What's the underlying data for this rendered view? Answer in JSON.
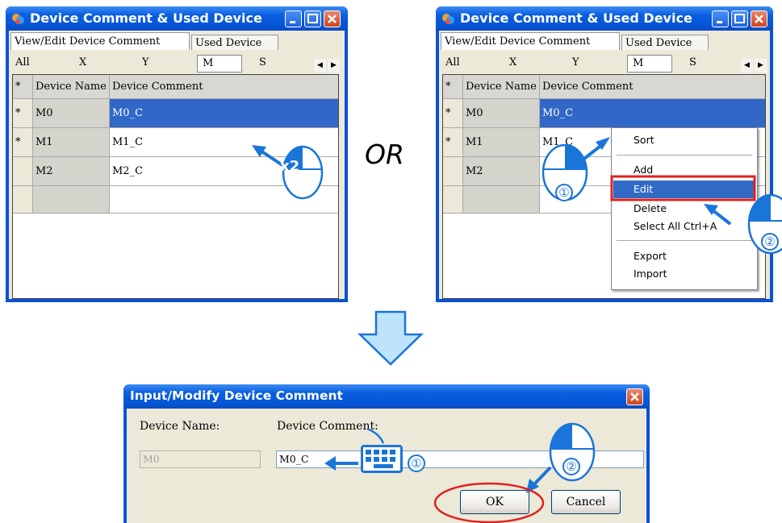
{
  "window_title": "Device Comment & Used Device",
  "tabs": [
    "View/Edit Device Comment",
    "Used Device"
  ],
  "filters": [
    "All",
    "X",
    "Y",
    "M",
    "S"
  ],
  "selected_filter": "M",
  "table": {
    "headers": [
      "*",
      "Device Name",
      "Device Comment"
    ],
    "rows": [
      {
        "mark": "*",
        "name": "M0",
        "comment": "M0_C"
      },
      {
        "mark": "*",
        "name": "M1",
        "comment": "M1_C"
      },
      {
        "mark": "",
        "name": "M2",
        "comment": "M2_C"
      }
    ]
  },
  "or_label": "OR",
  "double_click_label": "x2",
  "context_menu": [
    "Sort",
    "Add",
    "Edit",
    "Delete",
    "Select All  Ctrl+A",
    "Export",
    "Import"
  ],
  "highlighted_menu_item": "Edit",
  "step_markers": [
    "①",
    "②"
  ],
  "dialog": {
    "title": "Input/Modify Device Comment",
    "device_name_label": "Device Name:",
    "device_comment_label": "Device Comment:",
    "device_name_value": "M0",
    "device_comment_value": "M0_C",
    "ok_label": "OK",
    "cancel_label": "Cancel"
  },
  "colors": {
    "titlebar_blue": "#0a5fe0",
    "selection_blue": "#3167c6",
    "annotation_blue": "#1a75d9",
    "highlight_red": "#e02020",
    "down_arrow_fill": "#bde4fa"
  }
}
